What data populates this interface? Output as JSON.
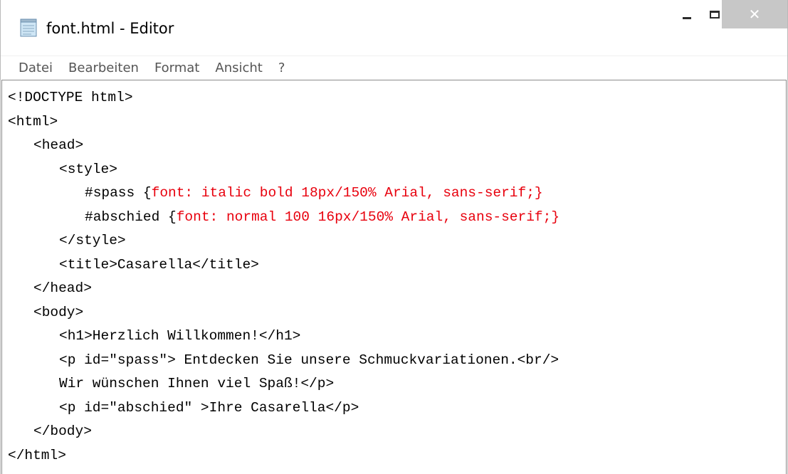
{
  "window": {
    "title": "font.html - Editor",
    "icon": "notepad-icon",
    "controls": {
      "minimize": "minimize-icon",
      "maximize": "maximize-icon",
      "close": "close-icon",
      "close_color": "#c7c7c7"
    }
  },
  "menu": {
    "items": [
      "Datei",
      "Bearbeiten",
      "Format",
      "Ansicht",
      "?"
    ]
  },
  "editor": {
    "lines": [
      "<!DOCTYPE html>",
      "<html>",
      "<head>",
      "<style>",
      "#spass {",
      "font: italic bold 18px/150% Arial, sans-serif;}",
      "#abschied {",
      "font: normal 100 16px/150% Arial, sans-serif;}",
      "</style>",
      "<title>Casarella</title>",
      "</head>",
      "<body>",
      "<h1>Herzlich Willkommen!</h1>",
      "<p id=\"spass\"> Entdecken Sie unsere Schmuckvariationen.<br/>",
      "Wir wünschen Ihnen viel Spaß!</p>",
      "<p id=\"abschied\" >Ihre Casarella</p>",
      "</body>",
      "</html>"
    ],
    "highlight_color": "#e8000d"
  }
}
